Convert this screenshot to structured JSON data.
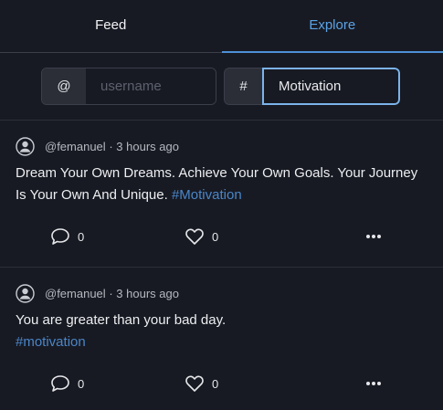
{
  "tabs": [
    {
      "label": "Feed",
      "active": false
    },
    {
      "label": "Explore",
      "active": true
    }
  ],
  "search": {
    "user_addon": "@",
    "user_placeholder": "username",
    "user_value": "",
    "tag_addon": "#",
    "tag_value": "Motivation"
  },
  "posts": [
    {
      "author": "@femanuel",
      "separator": "·",
      "time": "3 hours ago",
      "text": "Dream Your Own Dreams. Achieve Your Own Goals. Your Journey Is Your Own And Unique. ",
      "hashtag": "#Motivation",
      "comments": "0",
      "likes": "0"
    },
    {
      "author": "@femanuel",
      "separator": "·",
      "time": "3 hours ago",
      "text": "You are greater than your bad day. ",
      "hashtag": "#motivation",
      "comments": "0",
      "likes": "0"
    }
  ],
  "colors": {
    "background": "#181a23",
    "accent": "#5aa3e6",
    "hashtag": "#4a86c8"
  },
  "icons": {
    "avatar": "user-circle-icon",
    "comment": "speech-bubble-icon",
    "like": "heart-icon",
    "more": "ellipsis-icon"
  }
}
